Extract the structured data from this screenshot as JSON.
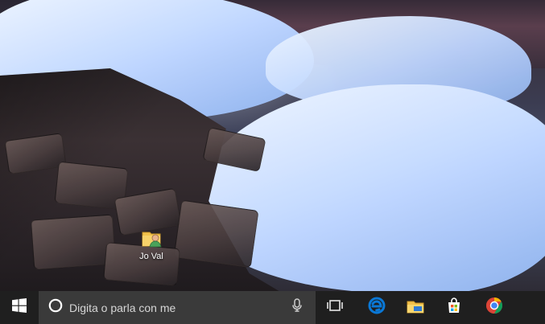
{
  "desktop": {
    "icons": [
      {
        "label": "Jo Val",
        "icon": "user-folder-icon"
      }
    ]
  },
  "taskbar": {
    "start_icon": "windows-logo-icon",
    "search": {
      "placeholder": "Digita o parla con me",
      "cortana_icon": "cortana-ring-icon",
      "mic_icon": "microphone-icon"
    },
    "pinned": [
      {
        "name": "Task View",
        "icon": "task-view-icon"
      },
      {
        "name": "Microsoft Edge",
        "icon": "edge-icon"
      },
      {
        "name": "File Explorer",
        "icon": "file-explorer-icon"
      },
      {
        "name": "Store",
        "icon": "store-icon"
      },
      {
        "name": "Google Chrome",
        "icon": "chrome-icon"
      }
    ],
    "colors": {
      "taskbar_bg": "#1f1f1f",
      "search_bg": "#3a3a3a",
      "accent_blue": "#0a78d7"
    }
  }
}
